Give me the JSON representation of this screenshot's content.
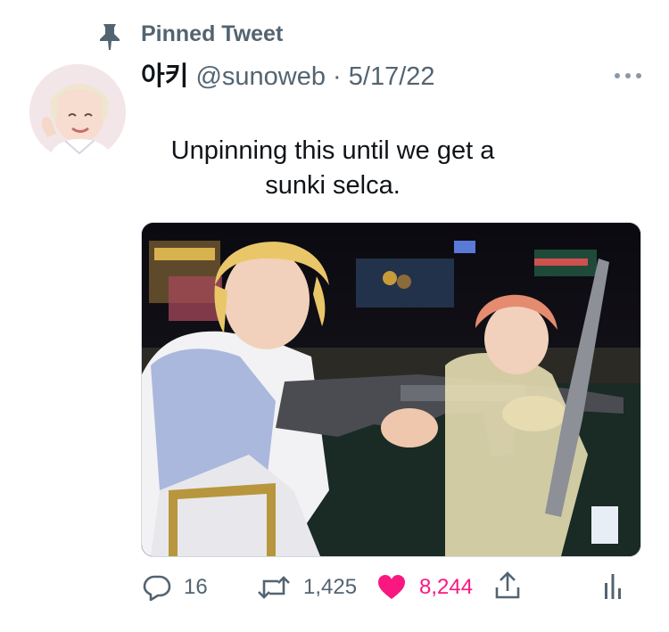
{
  "pinned": {
    "label": "Pinned Tweet"
  },
  "author": {
    "display_name": "아키",
    "handle": "@sunoweb",
    "separator": "·",
    "date": "5/17/22"
  },
  "tweet": {
    "text": "Unpinning this until we get a sunki selca."
  },
  "metrics": {
    "replies": "16",
    "retweets": "1,425",
    "likes": "8,244"
  },
  "state": {
    "liked": true
  },
  "colors": {
    "like_accent": "#f91880",
    "secondary_text": "#536471",
    "primary_text": "#0f1419"
  },
  "icons": {
    "pin": "pin-icon",
    "more": "more-icon",
    "reply": "reply-icon",
    "retweet": "retweet-icon",
    "like": "heart-filled-icon",
    "share": "share-icon",
    "analytics": "analytics-icon"
  }
}
